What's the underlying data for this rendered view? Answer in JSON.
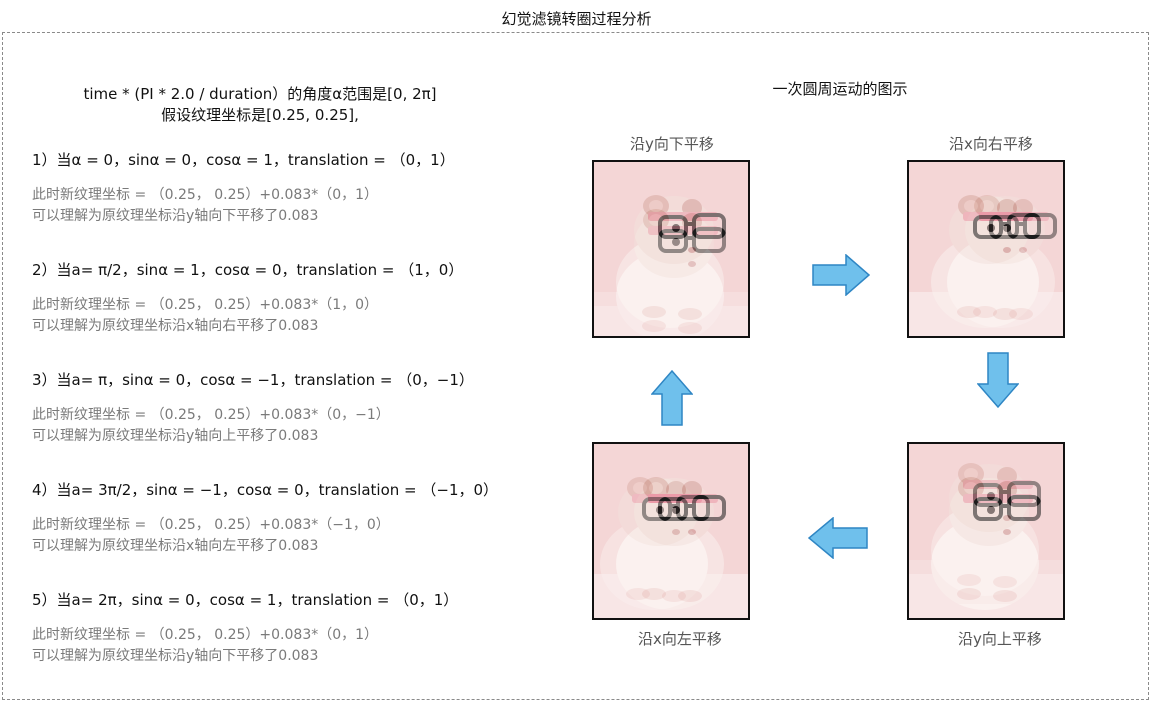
{
  "title": "幻觉滤镜转圈过程分析",
  "intro": {
    "line1": "time * (PI * 2.0 / duration）的角度α范围是[0, 2π]",
    "line2": "假设纹理坐标是[0.25, 0.25],"
  },
  "steps": [
    {
      "head": "1）当α = 0，sinα = 0，cosα = 1，translation = （0，1）",
      "line1": "此时新纹理坐标 = （0.25， 0.25）+0.083*（0，1）",
      "line2": "可以理解为原纹理坐标沿y轴向下平移了0.083"
    },
    {
      "head": "2）当a= π/2，sinα = 1，cosα = 0，translation = （1，0）",
      "line1": "此时新纹理坐标 = （0.25， 0.25）+0.083*（1，0）",
      "line2": "可以理解为原纹理坐标沿x轴向右平移了0.083"
    },
    {
      "head": "3）当a= π，sinα = 0，cosα = −1，translation = （0，−1）",
      "line1": "此时新纹理坐标 = （0.25， 0.25）+0.083*（0，−1）",
      "line2": "可以理解为原纹理坐标沿y轴向上平移了0.083"
    },
    {
      "head": "4）当a= 3π/2，sinα = −1，cosα = 0，translation = （−1，0）",
      "line1": "此时新纹理坐标 = （0.25， 0.25）+0.083*（−1，0）",
      "line2": "可以理解为原纹理坐标沿x轴向左平移了0.083"
    },
    {
      "head": "5）当a= 2π，sinα = 0，cosα = 1，translation = （0，1）",
      "line1": "此时新纹理坐标 = （0.25， 0.25）+0.083*（0，1）",
      "line2": "可以理解为原纹理坐标沿y轴向下平移了0.083"
    }
  ],
  "diagram": {
    "title": "一次圆周运动的图示",
    "panels": {
      "top_left": "沿y向下平移",
      "top_right": "沿x向右平移",
      "bottom_right": "沿y向上平移",
      "bottom_left": "沿x向左平移"
    },
    "arrow_color": "#6fc0ec"
  }
}
